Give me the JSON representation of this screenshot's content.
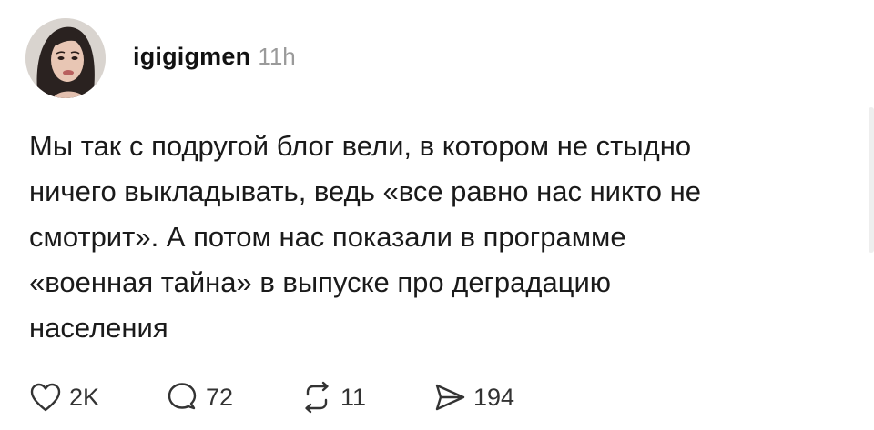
{
  "post": {
    "author": {
      "username": "igigigmen",
      "time": "11h"
    },
    "text": "Мы так с подругой блог вели, в котором не стыдно\nничего выкладывать, ведь «все равно нас никто не\nсмотрит». А потом нас показали в программе\n«военная тайна» в выпуске про деградацию\nнаселения",
    "actions": {
      "likes": "2K",
      "replies": "72",
      "reposts": "11",
      "shares": "194"
    }
  },
  "icons": {
    "like": "heart-icon",
    "reply": "comment-bubble-icon",
    "repost": "repost-arrows-icon",
    "share": "send-icon"
  },
  "colors": {
    "text": "#1a1a1a",
    "muted": "#9a9a9a",
    "icon": "#333333"
  }
}
